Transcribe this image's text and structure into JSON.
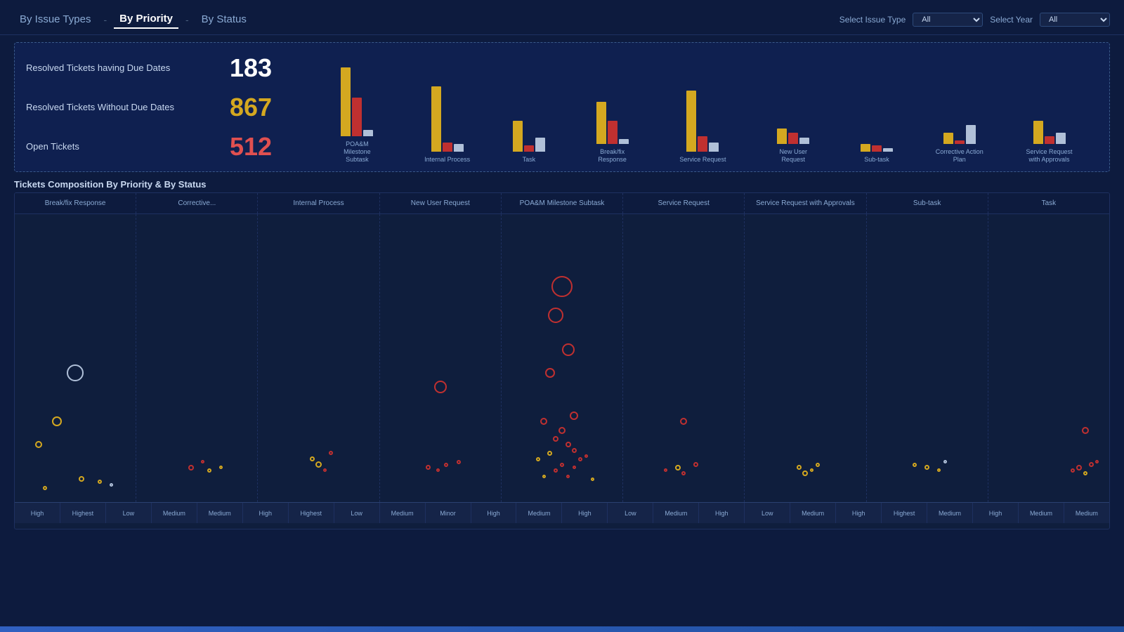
{
  "header": {
    "tabs": [
      {
        "label": "By Issue Types",
        "active": false
      },
      {
        "label": "By Priority",
        "active": true
      },
      {
        "label": "By Status",
        "active": false
      }
    ],
    "separators": [
      "-",
      "-"
    ]
  },
  "filters": {
    "issue_type_label": "Select Issue Type",
    "issue_type_value": "All",
    "year_label": "Select Year",
    "year_value": "All"
  },
  "summary": {
    "resolved_with_dates_label": "Resolved Tickets having Due Dates",
    "resolved_with_dates_value": "183",
    "resolved_without_dates_label": "Resolved Tickets Without Due Dates",
    "resolved_without_dates_value": "867",
    "open_tickets_label": "Open Tickets",
    "open_tickets_value": "512"
  },
  "bar_groups": [
    {
      "label": "POA&M Milestone\nSubtask",
      "gold": 90,
      "red": 50,
      "white": 8
    },
    {
      "label": "Internal Process",
      "gold": 85,
      "red": 12,
      "white": 10
    },
    {
      "label": "Task",
      "gold": 40,
      "red": 8,
      "white": 18
    },
    {
      "label": "Break/fix Response",
      "gold": 55,
      "red": 30,
      "white": 6
    },
    {
      "label": "Service Request",
      "gold": 80,
      "red": 20,
      "white": 12
    },
    {
      "label": "New User Request",
      "gold": 20,
      "red": 15,
      "white": 8
    },
    {
      "label": "Sub-task",
      "gold": 10,
      "red": 8,
      "white": 5
    },
    {
      "label": "Corrective Action\nPlan",
      "gold": 15,
      "red": 5,
      "white": 25
    },
    {
      "label": "Service Request\nwith Approvals",
      "gold": 30,
      "red": 10,
      "white": 15
    }
  ],
  "scatter": {
    "title": "Tickets Composition By Priority & By Status",
    "columns": [
      "Break/fix Response",
      "Corrective...",
      "Internal Process",
      "New User Request",
      "POA&M Milestone Subtask",
      "Service Request",
      "Service Request with Approvals",
      "Sub-task",
      "Task"
    ],
    "axis_labels": [
      "High",
      "Highest",
      "Low",
      "Medium",
      "Medium",
      "High",
      "Highest",
      "Low",
      "Medium",
      "Minor",
      "High",
      "Medium",
      "High",
      "Low",
      "Medium",
      "High",
      "Low",
      "Medium",
      "High",
      "Highest",
      "Medium",
      "High",
      "Medium",
      "Medium"
    ]
  }
}
